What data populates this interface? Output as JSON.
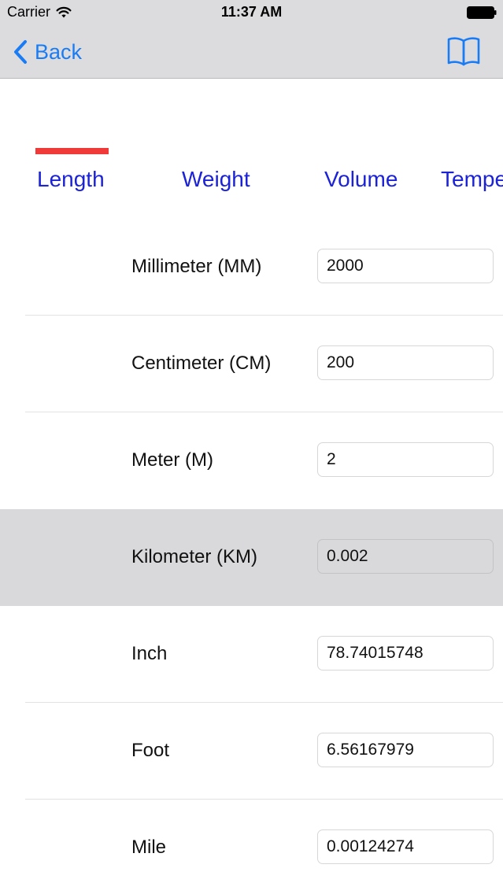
{
  "status_bar": {
    "carrier": "Carrier",
    "time": "11:37 AM"
  },
  "nav": {
    "back_label": "Back",
    "icons": {
      "back": "chevron-left-icon",
      "book": "book-icon"
    }
  },
  "tabs": [
    {
      "label": "Length",
      "selected": true
    },
    {
      "label": "Weight",
      "selected": false
    },
    {
      "label": "Volume",
      "selected": false
    },
    {
      "label": "Tempe",
      "selected": false
    }
  ],
  "units": [
    {
      "label": "Millimeter (MM)",
      "value": "2000"
    },
    {
      "label": "Centimeter (CM)",
      "value": "200"
    },
    {
      "label": "Meter (M)",
      "value": "2"
    },
    {
      "label": "Kilometer (KM)",
      "value": "0.002",
      "selected": true
    },
    {
      "label": "Inch",
      "value": "78.74015748"
    },
    {
      "label": "Foot",
      "value": "6.56167979"
    },
    {
      "label": "Mile",
      "value": "0.00124274"
    }
  ],
  "colors": {
    "accent": "#1a7cf5",
    "tab_text": "#1c22d6",
    "tab_indicator": "#f03a3a",
    "nav_bar": "#dcdcde",
    "selected_row": "#d9d9db"
  }
}
